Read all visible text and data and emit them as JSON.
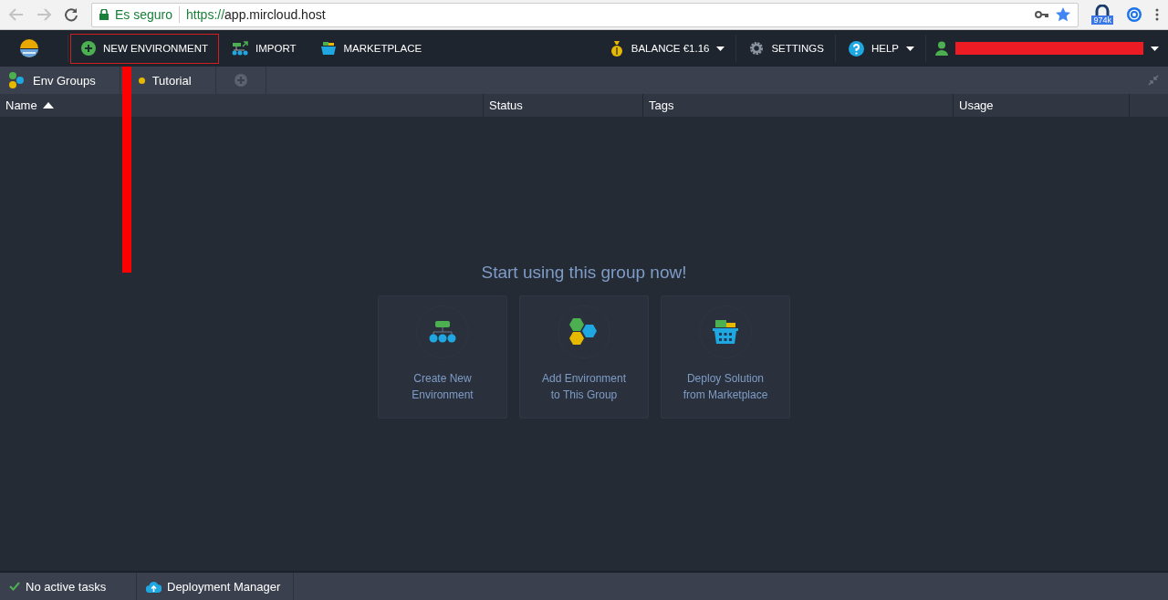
{
  "browser": {
    "security": "Es seguro",
    "url_scheme": "https://",
    "url_host": "app.mircloud.host",
    "extension_badge": "974k"
  },
  "toolbar": {
    "left": [
      {
        "kind": "new",
        "label": "NEW ENVIRONMENT",
        "highlighted": true
      },
      {
        "kind": "import",
        "label": "IMPORT",
        "highlighted": false
      },
      {
        "kind": "marketplace",
        "label": "MARKETPLACE",
        "highlighted": false
      }
    ],
    "right": [
      {
        "kind": "balance",
        "label": "BALANCE €1.16",
        "dropdown": true
      },
      {
        "kind": "settings",
        "label": "SETTINGS",
        "dropdown": false
      },
      {
        "kind": "help",
        "label": "HELP",
        "dropdown": true
      }
    ]
  },
  "breadcrumb": [
    {
      "label": "Env Groups",
      "kind": "groups"
    },
    {
      "label": "Tutorial",
      "kind": "group",
      "color": "#e6b800"
    }
  ],
  "table": {
    "columns": [
      {
        "label": "Name",
        "sorted": true
      },
      {
        "label": "Status",
        "sorted": false
      },
      {
        "label": "Tags",
        "sorted": false
      },
      {
        "label": "Usage",
        "sorted": false
      }
    ]
  },
  "empty_state": {
    "title": "Start using this group now!",
    "cards": [
      {
        "kind": "create",
        "line1": "Create New",
        "line2": "Environment"
      },
      {
        "kind": "add",
        "line1": "Add Environment",
        "line2": "to This Group"
      },
      {
        "kind": "deploy",
        "line1": "Deploy Solution",
        "line2": "from Marketplace"
      }
    ]
  },
  "status_bar": {
    "tasks": "No active tasks",
    "deployment": "Deployment Manager"
  }
}
